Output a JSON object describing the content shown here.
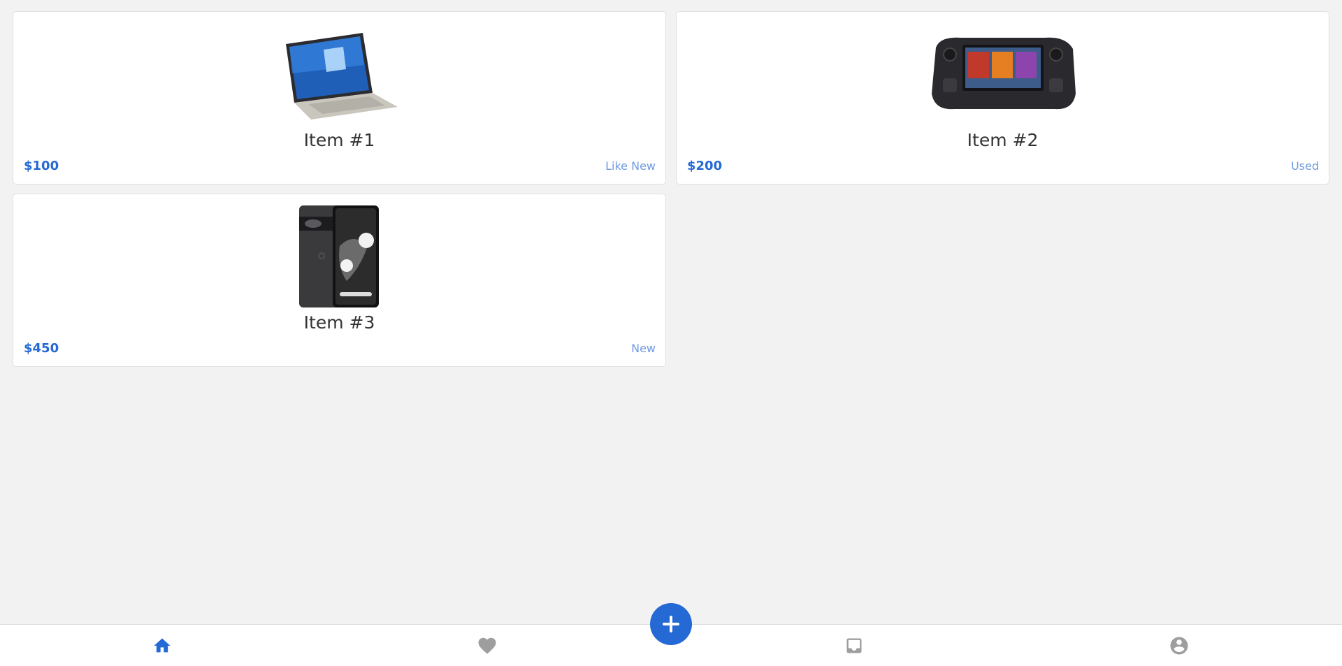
{
  "items": [
    {
      "title": "Item #1",
      "price": "$100",
      "condition": "Like New",
      "image_icon": "laptop-image"
    },
    {
      "title": "Item #2",
      "price": "$200",
      "condition": "Used",
      "image_icon": "handheld-console-image"
    },
    {
      "title": "Item #3",
      "price": "$450",
      "condition": "New",
      "image_icon": "smartphone-image"
    }
  ],
  "bottom_nav": {
    "items": [
      {
        "icon": "home-icon",
        "active": true
      },
      {
        "icon": "heart-icon",
        "active": false
      },
      {
        "icon": "inbox-icon",
        "active": false
      },
      {
        "icon": "account-icon",
        "active": false
      }
    ],
    "fab_icon": "plus-icon"
  },
  "colors": {
    "accent": "#2469d4",
    "condition_text": "#6f9ae0",
    "inactive_icon": "#9e9e9e",
    "background": "#f2f2f2"
  }
}
